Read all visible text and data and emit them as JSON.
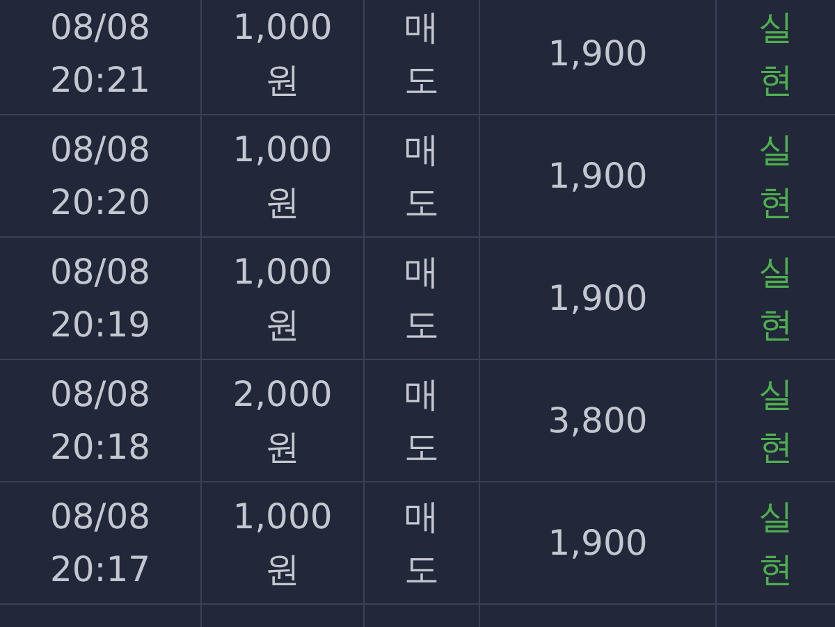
{
  "rows": [
    {
      "date": "08/08",
      "time": "20:21",
      "amount": "1,000",
      "unit": "원",
      "side": "매도",
      "price": "1,900",
      "status": "실현"
    },
    {
      "date": "08/08",
      "time": "20:20",
      "amount": "1,000",
      "unit": "원",
      "side": "매도",
      "price": "1,900",
      "status": "실현"
    },
    {
      "date": "08/08",
      "time": "20:19",
      "amount": "1,000",
      "unit": "원",
      "side": "매도",
      "price": "1,900",
      "status": "실현"
    },
    {
      "date": "08/08",
      "time": "20:18",
      "amount": "2,000",
      "unit": "원",
      "side": "매도",
      "price": "3,800",
      "status": "실현"
    },
    {
      "date": "08/08",
      "time": "20:17",
      "amount": "1,000",
      "unit": "원",
      "side": "매도",
      "price": "1,900",
      "status": "실현"
    }
  ]
}
